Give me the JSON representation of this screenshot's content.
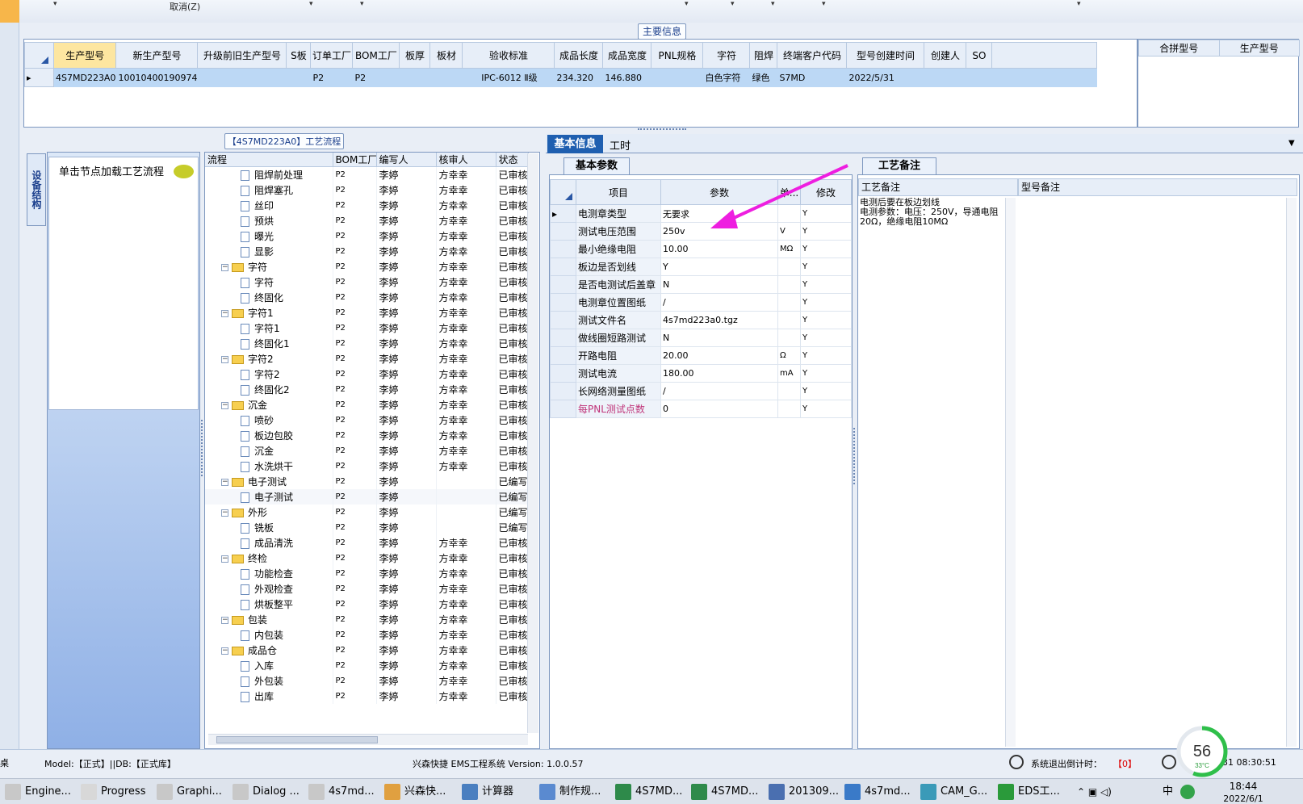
{
  "toolbar": {
    "cancel_label": "取消(Z)"
  },
  "main_info": {
    "caption": "主要信息",
    "columns": [
      "生产型号",
      "新生产型号",
      "升级前旧生产型号",
      "S板",
      "订单工厂",
      "BOM工厂",
      "板厚",
      "板材",
      "验收标准",
      "成品长度",
      "成品宽度",
      "PNL规格",
      "字符",
      "阻焊",
      "终端客户代码",
      "型号创建时间",
      "创建人",
      "SO"
    ],
    "row": [
      "4S7MD223A0",
      "10010400190974",
      "",
      "",
      "P2",
      "P2",
      "",
      "",
      "IPC-6012 Ⅱ级",
      "234.320",
      "146.880",
      "",
      "白色字符",
      "绿色",
      "S7MD",
      "2022/5/31",
      "",
      ""
    ]
  },
  "combine": {
    "columns": [
      "合拼型号",
      "生产型号"
    ]
  },
  "process": {
    "caption": "【4S7MD223A0】工艺流程",
    "vertical_tab": "设备结构",
    "load_hint": "单击节点加载工艺流程",
    "columns": [
      "流程",
      "BOM工厂",
      "编写人",
      "核审人",
      "状态"
    ],
    "rows": [
      {
        "name": "阻焊前处理",
        "level": 1,
        "bom": "P2",
        "writer": "李婷",
        "reviewer": "方幸幸",
        "status": "已审核"
      },
      {
        "name": "阻焊塞孔",
        "level": 1,
        "bom": "P2",
        "writer": "李婷",
        "reviewer": "方幸幸",
        "status": "已审核"
      },
      {
        "name": "丝印",
        "level": 1,
        "bom": "P2",
        "writer": "李婷",
        "reviewer": "方幸幸",
        "status": "已审核"
      },
      {
        "name": "预烘",
        "level": 1,
        "bom": "P2",
        "writer": "李婷",
        "reviewer": "方幸幸",
        "status": "已审核"
      },
      {
        "name": "曝光",
        "level": 1,
        "bom": "P2",
        "writer": "李婷",
        "reviewer": "方幸幸",
        "status": "已审核"
      },
      {
        "name": "显影",
        "level": 1,
        "bom": "P2",
        "writer": "李婷",
        "reviewer": "方幸幸",
        "status": "已审核"
      },
      {
        "name": "字符",
        "level": 0,
        "bom": "P2",
        "writer": "李婷",
        "reviewer": "方幸幸",
        "status": "已审核"
      },
      {
        "name": "字符",
        "level": 1,
        "bom": "P2",
        "writer": "李婷",
        "reviewer": "方幸幸",
        "status": "已审核"
      },
      {
        "name": "终固化",
        "level": 1,
        "bom": "P2",
        "writer": "李婷",
        "reviewer": "方幸幸",
        "status": "已审核"
      },
      {
        "name": "字符1",
        "level": 0,
        "bom": "P2",
        "writer": "李婷",
        "reviewer": "方幸幸",
        "status": "已审核"
      },
      {
        "name": "字符1",
        "level": 1,
        "bom": "P2",
        "writer": "李婷",
        "reviewer": "方幸幸",
        "status": "已审核"
      },
      {
        "name": "终固化1",
        "level": 1,
        "bom": "P2",
        "writer": "李婷",
        "reviewer": "方幸幸",
        "status": "已审核"
      },
      {
        "name": "字符2",
        "level": 0,
        "bom": "P2",
        "writer": "李婷",
        "reviewer": "方幸幸",
        "status": "已审核"
      },
      {
        "name": "字符2",
        "level": 1,
        "bom": "P2",
        "writer": "李婷",
        "reviewer": "方幸幸",
        "status": "已审核"
      },
      {
        "name": "终固化2",
        "level": 1,
        "bom": "P2",
        "writer": "李婷",
        "reviewer": "方幸幸",
        "status": "已审核"
      },
      {
        "name": "沉金",
        "level": 0,
        "bom": "P2",
        "writer": "李婷",
        "reviewer": "方幸幸",
        "status": "已审核"
      },
      {
        "name": "喷砂",
        "level": 1,
        "bom": "P2",
        "writer": "李婷",
        "reviewer": "方幸幸",
        "status": "已审核"
      },
      {
        "name": "板边包胶",
        "level": 1,
        "bom": "P2",
        "writer": "李婷",
        "reviewer": "方幸幸",
        "status": "已审核"
      },
      {
        "name": "沉金",
        "level": 1,
        "bom": "P2",
        "writer": "李婷",
        "reviewer": "方幸幸",
        "status": "已审核"
      },
      {
        "name": "水洗烘干",
        "level": 1,
        "bom": "P2",
        "writer": "李婷",
        "reviewer": "方幸幸",
        "status": "已审核"
      },
      {
        "name": "电子测试",
        "level": 0,
        "bom": "P2",
        "writer": "李婷",
        "reviewer": "",
        "status": "已编写"
      },
      {
        "name": "电子测试",
        "level": 1,
        "bom": "P2",
        "writer": "李婷",
        "reviewer": "",
        "status": "已编写"
      },
      {
        "name": "外形",
        "level": 0,
        "bom": "P2",
        "writer": "李婷",
        "reviewer": "",
        "status": "已编写"
      },
      {
        "name": "铣板",
        "level": 1,
        "bom": "P2",
        "writer": "李婷",
        "reviewer": "",
        "status": "已编写"
      },
      {
        "name": "成品清洗",
        "level": 1,
        "bom": "P2",
        "writer": "李婷",
        "reviewer": "方幸幸",
        "status": "已审核"
      },
      {
        "name": "终检",
        "level": 0,
        "bom": "P2",
        "writer": "李婷",
        "reviewer": "方幸幸",
        "status": "已审核"
      },
      {
        "name": "功能检查",
        "level": 1,
        "bom": "P2",
        "writer": "李婷",
        "reviewer": "方幸幸",
        "status": "已审核"
      },
      {
        "name": "外观检查",
        "level": 1,
        "bom": "P2",
        "writer": "李婷",
        "reviewer": "方幸幸",
        "status": "已审核"
      },
      {
        "name": "烘板整平",
        "level": 1,
        "bom": "P2",
        "writer": "李婷",
        "reviewer": "方幸幸",
        "status": "已审核"
      },
      {
        "name": "包装",
        "level": 0,
        "bom": "P2",
        "writer": "李婷",
        "reviewer": "方幸幸",
        "status": "已审核"
      },
      {
        "name": "内包装",
        "level": 1,
        "bom": "P2",
        "writer": "李婷",
        "reviewer": "方幸幸",
        "status": "已审核"
      },
      {
        "name": "成品仓",
        "level": 0,
        "bom": "P2",
        "writer": "李婷",
        "reviewer": "方幸幸",
        "status": "已审核"
      },
      {
        "name": "入库",
        "level": 1,
        "bom": "P2",
        "writer": "李婷",
        "reviewer": "方幸幸",
        "status": "已审核"
      },
      {
        "name": "外包装",
        "level": 1,
        "bom": "P2",
        "writer": "李婷",
        "reviewer": "方幸幸",
        "status": "已审核"
      },
      {
        "name": "出库",
        "level": 1,
        "bom": "P2",
        "writer": "李婷",
        "reviewer": "方幸幸",
        "status": "已审核"
      }
    ]
  },
  "detail_tabs": [
    "基本信息",
    "工时"
  ],
  "params": {
    "tab": "基本参数",
    "columns": [
      "项目",
      "参数",
      "单...",
      "修改"
    ],
    "rows": [
      {
        "name": "电测章类型",
        "value": "无要求",
        "unit": "",
        "edit": "Y"
      },
      {
        "name": "测试电压范围",
        "value": "250v",
        "unit": "V",
        "edit": "Y"
      },
      {
        "name": "最小绝缘电阻",
        "value": "10.00",
        "unit": "MΩ",
        "edit": "Y"
      },
      {
        "name": "板边是否划线",
        "value": "Y",
        "unit": "",
        "edit": "Y"
      },
      {
        "name": "是否电测试后盖章",
        "value": "N",
        "unit": "",
        "edit": "Y"
      },
      {
        "name": "电测章位置图纸",
        "value": "/",
        "unit": "",
        "edit": "Y"
      },
      {
        "name": "测试文件名",
        "value": "4s7md223a0.tgz",
        "unit": "",
        "edit": "Y"
      },
      {
        "name": "做线圈短路测试",
        "value": "N",
        "unit": "",
        "edit": "Y"
      },
      {
        "name": "开路电阻",
        "value": "20.00",
        "unit": "Ω",
        "edit": "Y"
      },
      {
        "name": "测试电流",
        "value": "180.00",
        "unit": "mA",
        "edit": "Y"
      },
      {
        "name": "长网络测量图纸",
        "value": "/",
        "unit": "",
        "edit": "Y"
      },
      {
        "name": "每PNL测试点数",
        "value": "0",
        "unit": "",
        "edit": "Y"
      }
    ]
  },
  "notes": {
    "tab": "工艺备注",
    "col1": "工艺备注",
    "col2": "型号备注",
    "text": "电测后要在板边划线\n电测参数：电压：250V，导通电阻20Ω，绝缘电阻10MΩ"
  },
  "status": {
    "model": "Model:【正式】||DB:【正式库】",
    "app": "兴森快捷 EMS工程系统 Version: 1.0.0.57",
    "countdown_label": "系统退出倒计时：",
    "countdown": "【0】",
    "time": "31 08:30:51",
    "cpu": "56",
    "temp": "33°C",
    "cpu_pct": 0.56,
    "left_edge": "桌"
  },
  "taskbar": {
    "items": [
      "Engine...",
      "Progress",
      "Graphi...",
      "Dialog ...",
      "4s7md...",
      "兴森快...",
      "计算器",
      "制作规...",
      "4S7MD...",
      "4S7MD...",
      "201309...",
      "4s7md...",
      "CAM_G...",
      "EDS工..."
    ],
    "time": "18:44",
    "date": "2022/6/1",
    "ime": "中"
  },
  "colors": {
    "accent": "#1f5fb0",
    "selection": "#bcd8f5",
    "arrow": "#ee1ee0"
  }
}
